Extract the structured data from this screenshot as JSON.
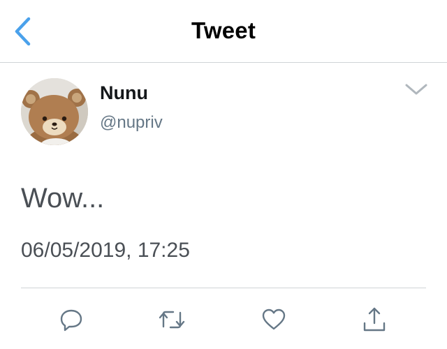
{
  "header": {
    "title": "Tweet",
    "back_icon": "chevron-left-icon",
    "accent_color": "#4aa1eb"
  },
  "tweet": {
    "author": {
      "name": "Nunu",
      "handle": "@nupriv",
      "avatar": "teddy-bear-avatar"
    },
    "text": "Wow...",
    "timestamp": "06/05/2019, 17:25",
    "menu_icon": "chevron-down-icon"
  },
  "actions": [
    {
      "name": "reply",
      "icon": "reply-icon"
    },
    {
      "name": "retweet",
      "icon": "retweet-icon"
    },
    {
      "name": "like",
      "icon": "heart-icon"
    },
    {
      "name": "share",
      "icon": "share-icon"
    }
  ],
  "colors": {
    "icon_gray": "#657786",
    "text_dark": "#14171a",
    "text_body": "#4a4f55",
    "divider": "#cfd3d6"
  }
}
